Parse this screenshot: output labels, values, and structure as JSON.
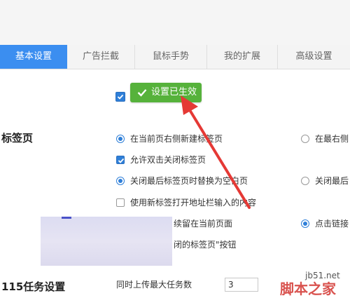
{
  "tabs": [
    {
      "label": "基本设置",
      "active": true
    },
    {
      "label": "广告拦截",
      "active": false
    },
    {
      "label": "鼠标手势",
      "active": false
    },
    {
      "label": "我的扩展",
      "active": false
    },
    {
      "label": "高级设置",
      "active": false
    }
  ],
  "toast": {
    "message": "设置已生效",
    "color": "#56b23b"
  },
  "tab_section": {
    "title": "标签页",
    "opt_new_tab_right": "在当前页右侧新建标签页",
    "opt_new_tab_far_right": "在最右侧",
    "opt_dblclick_close": "允许双击关闭标签页",
    "opt_replace_blank": "关闭最后标签页时替换为空白页",
    "opt_close_last": "关闭最后",
    "opt_address_bar_new_tab": "使用新标签打开地址栏输入的内容",
    "opt_stay_current": "续留在当前页面",
    "opt_click_link": "点击链接",
    "opt_closed_tabs_button": "闭的标签页\"按钮"
  },
  "task_section": {
    "title": "115任务设置",
    "max_upload_label": "同时上传最大任务数",
    "max_upload_value": "3"
  },
  "watermark": {
    "site": "jb51.net",
    "brand": "脚本之家"
  },
  "accent_color": "#3b8ef0",
  "arrow_color": "#e53935"
}
